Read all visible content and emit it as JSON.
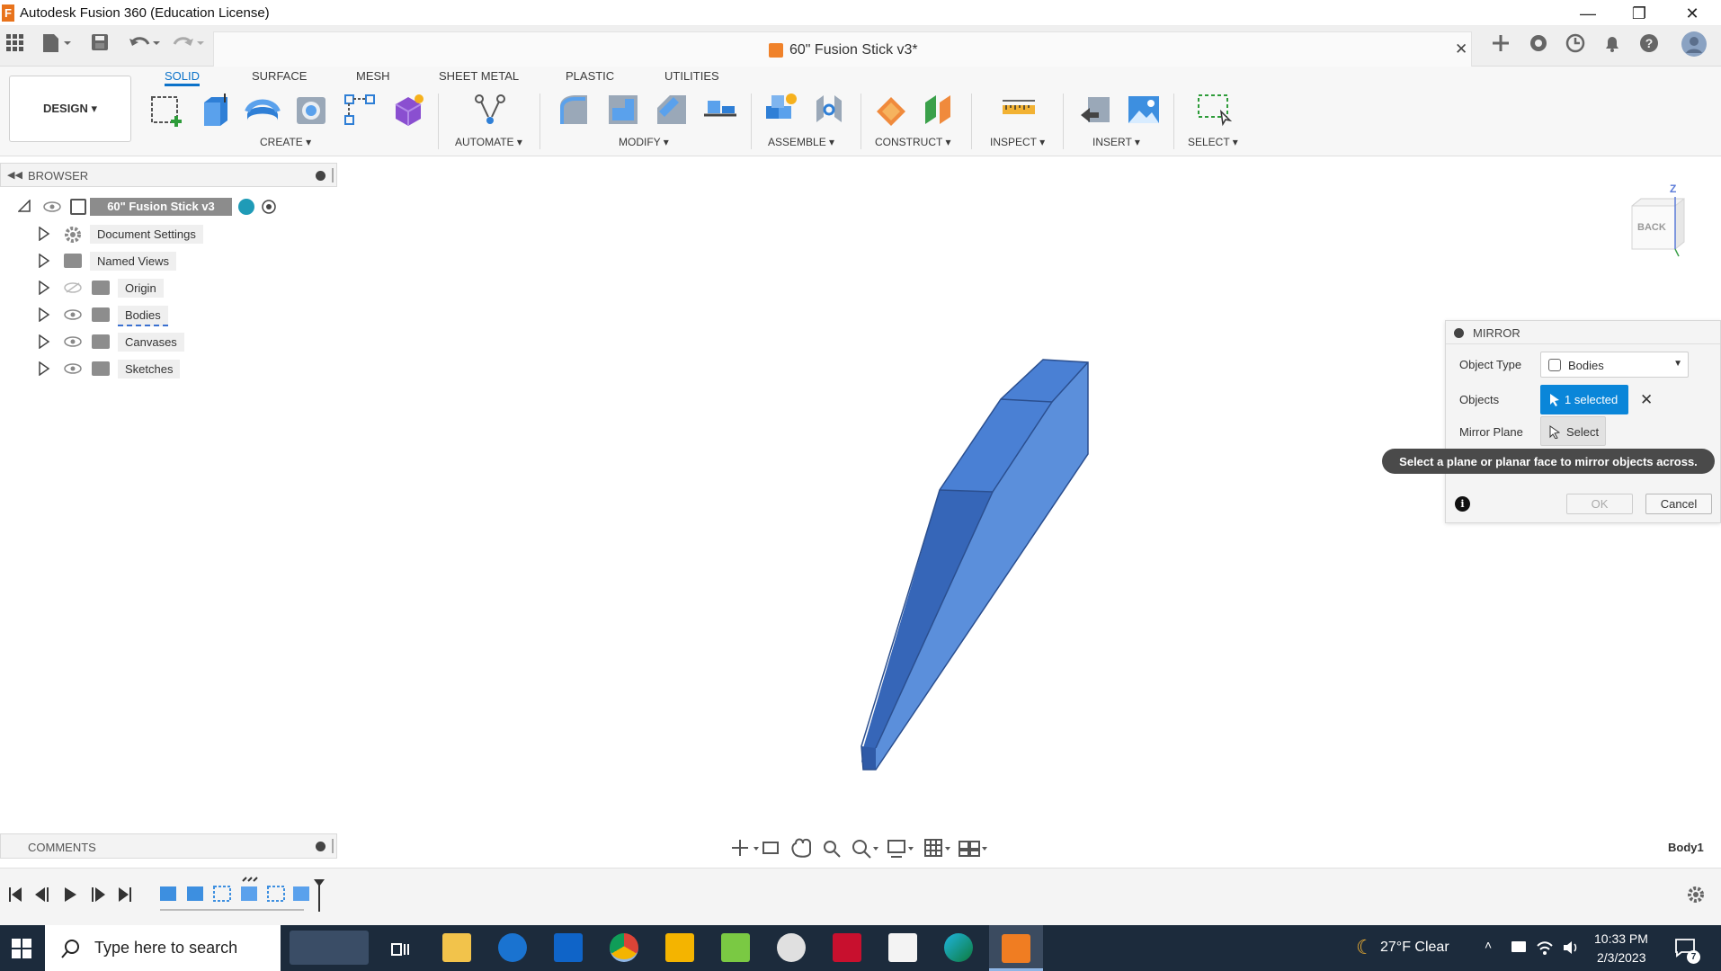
{
  "window": {
    "title": "Autodesk Fusion 360 (Education License)"
  },
  "document_tab": {
    "title": "60\" Fusion Stick v3*"
  },
  "workspace": {
    "label": "DESIGN ▾"
  },
  "ribbon_tabs": [
    "SOLID",
    "SURFACE",
    "MESH",
    "SHEET METAL",
    "PLASTIC",
    "UTILITIES"
  ],
  "tool_groups": {
    "create": "CREATE ▾",
    "automate": "AUTOMATE ▾",
    "modify": "MODIFY ▾",
    "assemble": "ASSEMBLE ▾",
    "construct": "CONSTRUCT ▾",
    "inspect": "INSPECT ▾",
    "insert": "INSERT ▾",
    "select": "SELECT ▾"
  },
  "browser": {
    "title": "BROWSER",
    "root": "60\" Fusion Stick v3",
    "items": [
      "Document Settings",
      "Named Views",
      "Origin",
      "Bodies",
      "Canvases",
      "Sketches"
    ]
  },
  "viewcube": {
    "face": "BACK",
    "axis": "Z"
  },
  "mirror_dialog": {
    "title": "MIRROR",
    "object_type_label": "Object Type",
    "object_type_value": "Bodies",
    "objects_label": "Objects",
    "objects_value": "1 selected",
    "mirror_plane_label": "Mirror Plane",
    "mirror_plane_value": "Select",
    "ok": "OK",
    "cancel": "Cancel",
    "tooltip": "Select a plane or planar face to mirror objects across."
  },
  "comments": {
    "title": "COMMENTS"
  },
  "selection_label": "Body1",
  "taskbar": {
    "search_placeholder": "Type here to search",
    "weather": "27°F  Clear",
    "time": "10:33 PM",
    "date": "2/3/2023",
    "notification_count": "7"
  },
  "colors": {
    "accent": "#0b72c9",
    "selected_button": "#0a86d9",
    "body_dark": "#3d6fc4",
    "body_light": "#5b8fdb",
    "taskbar": "#1c2b3c"
  }
}
